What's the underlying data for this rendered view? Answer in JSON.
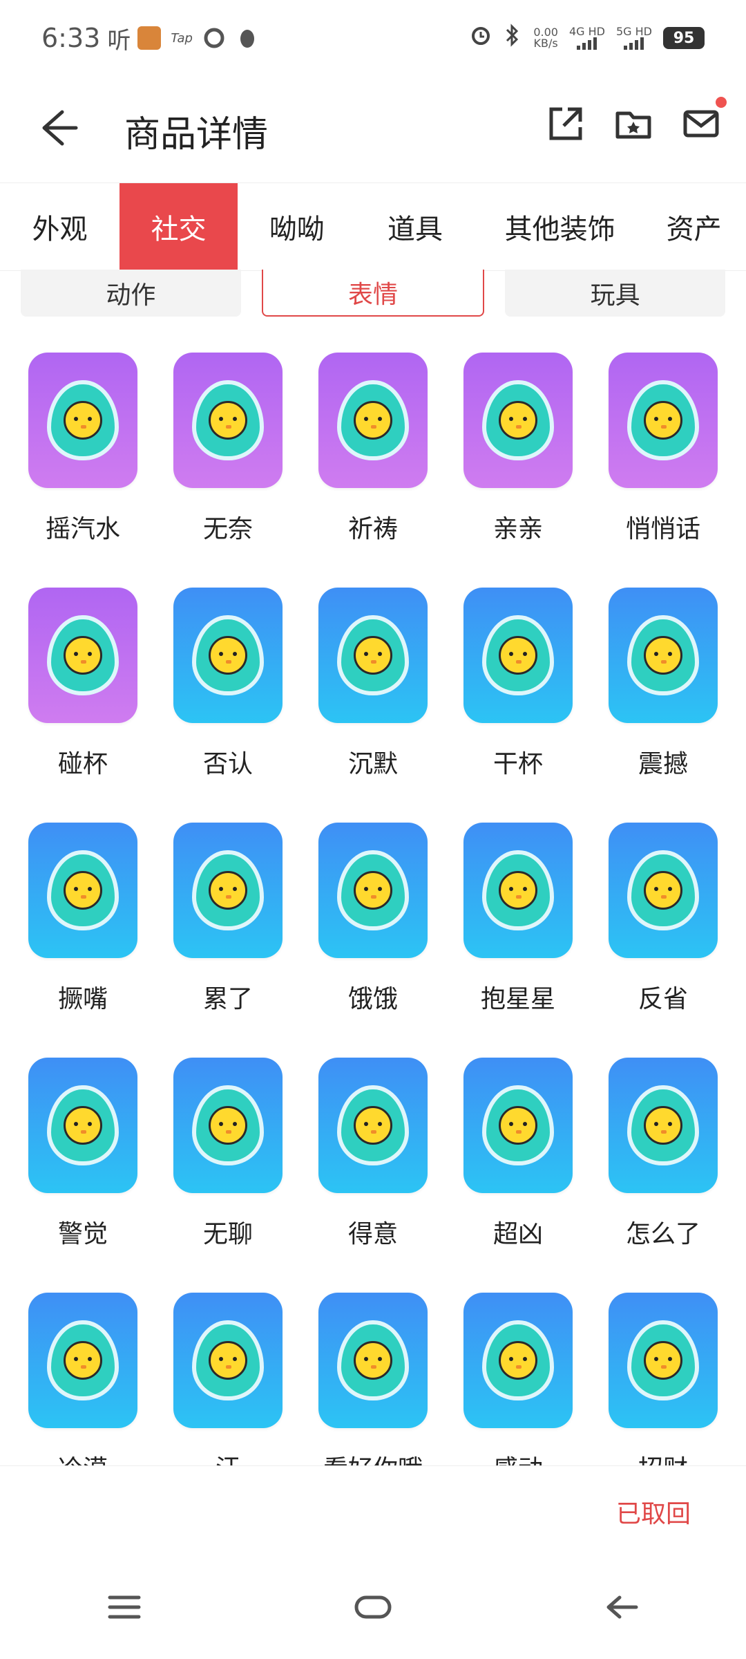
{
  "status": {
    "time": "6:33",
    "ting": "听",
    "tap": "Tap",
    "net_speed_value": "0.00",
    "net_speed_unit": "KB/s",
    "sig1": "4G HD",
    "sig2": "5G HD",
    "battery": "95"
  },
  "header": {
    "title": "商品详情"
  },
  "tabs": [
    "外观",
    "社交",
    "呦呦",
    "道具",
    "其他装饰",
    "资产"
  ],
  "active_tab": "社交",
  "subtabs": [
    "动作",
    "表情",
    "玩具"
  ],
  "active_subtab": "表情",
  "items": [
    {
      "label": "摇汽水",
      "color": "purple"
    },
    {
      "label": "无奈",
      "color": "purple"
    },
    {
      "label": "祈祷",
      "color": "purple"
    },
    {
      "label": "亲亲",
      "color": "purple"
    },
    {
      "label": "悄悄话",
      "color": "purple"
    },
    {
      "label": "碰杯",
      "color": "purple"
    },
    {
      "label": "否认",
      "color": "blue"
    },
    {
      "label": "沉默",
      "color": "blue"
    },
    {
      "label": "干杯",
      "color": "blue"
    },
    {
      "label": "震撼",
      "color": "blue"
    },
    {
      "label": "撅嘴",
      "color": "blue"
    },
    {
      "label": "累了",
      "color": "blue"
    },
    {
      "label": "饿饿",
      "color": "blue"
    },
    {
      "label": "抱星星",
      "color": "blue"
    },
    {
      "label": "反省",
      "color": "blue"
    },
    {
      "label": "警觉",
      "color": "blue"
    },
    {
      "label": "无聊",
      "color": "blue"
    },
    {
      "label": "得意",
      "color": "blue"
    },
    {
      "label": "超凶",
      "color": "blue"
    },
    {
      "label": "怎么了",
      "color": "blue"
    },
    {
      "label": "冷漠",
      "color": "blue"
    },
    {
      "label": "汗",
      "color": "blue"
    },
    {
      "label": "看好你哦",
      "color": "blue"
    },
    {
      "label": "感动",
      "color": "blue"
    },
    {
      "label": "招财",
      "color": "blue"
    }
  ],
  "colors": {
    "accent": "#e9484c",
    "purple_tile": "#b066f2",
    "blue_tile": "#3f8ff5"
  },
  "bottom": {
    "status_text": "已取回"
  }
}
